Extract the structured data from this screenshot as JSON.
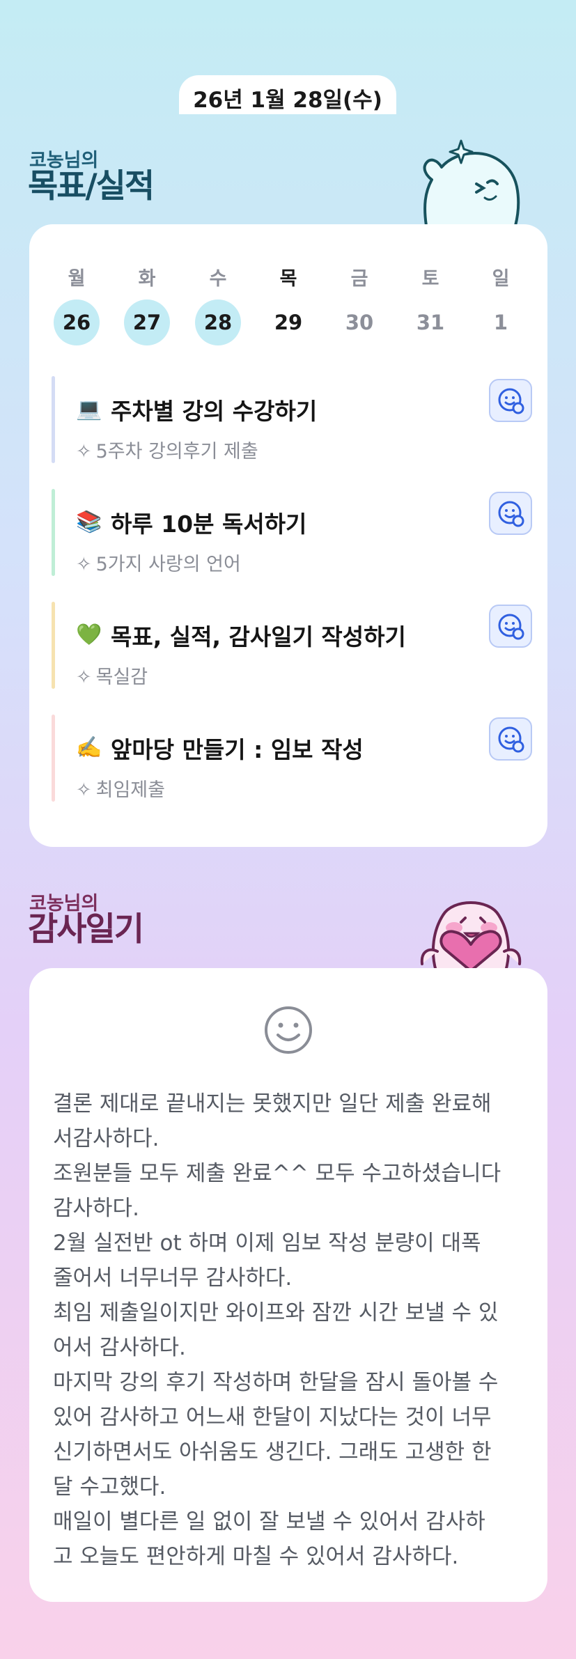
{
  "date": "26년 1월 28일(수)",
  "goals_section": {
    "owner_label": "코농님의",
    "title": "목표/실적"
  },
  "calendar": {
    "days": [
      {
        "weekday": "월",
        "num": "26",
        "state": "active"
      },
      {
        "weekday": "화",
        "num": "27",
        "state": "active"
      },
      {
        "weekday": "수",
        "num": "28",
        "state": "active"
      },
      {
        "weekday": "목",
        "num": "29",
        "state": "today"
      },
      {
        "weekday": "금",
        "num": "30",
        "state": "future"
      },
      {
        "weekday": "토",
        "num": "31",
        "state": "future"
      },
      {
        "weekday": "일",
        "num": "1",
        "state": "future"
      }
    ]
  },
  "goals": [
    {
      "icon": "laptop-icon",
      "emoji": "💻",
      "title": "주차별 강의 수강하기",
      "result": "5주차 강의후기 제출",
      "bar_color": "#d4dcf5"
    },
    {
      "icon": "books-icon",
      "emoji": "📚",
      "title": "하루 10분 독서하기",
      "result": "5가지 사랑의 언어",
      "bar_color": "#bfeed6"
    },
    {
      "icon": "green-heart-icon",
      "emoji": "💚",
      "title": "목표, 실적, 감사일기 작성하기",
      "result": "목실감",
      "bar_color": "#f6e2b0"
    },
    {
      "icon": "writing-hand-icon",
      "emoji": "✍️",
      "title": "앞마당 만들기 : 임보 작성",
      "result": "최임제출",
      "bar_color": "#fadada"
    }
  ],
  "diary_section": {
    "owner_label": "코농님의",
    "title": "감사일기"
  },
  "diary": {
    "text": "결론 제대로 끝내지는 못했지만 일단 제출 완료해\n서감사하다.\n조원분들 모두 제출 완료^^ 모두 수고하셨습니다\n감사하다.\n2월 실전반 ot 하며 이제 임보 작성 분량이 대폭\n줄어서 너무너무 감사하다.\n최임 제출일이지만 와이프와 잠깐 시간 보낼 수 있\n어서 감사하다.\n마지막 강의 후기 작성하며 한달을 잠시 돌아볼 수\n있어 감사하고 어느새 한달이 지났다는 것이 너무\n신기하면서도 아쉬움도 생긴다. 그래도 고생한 한\n달 수고했다.\n매일이 별다른 일 없이 잘 보낼 수 있어서 감사하\n고 오늘도 편안하게 마칠 수 있어서 감사하다."
  },
  "colors": {
    "accent_blue": "#2f5fe0",
    "active_day": "#c3ecf5",
    "goal_title": "#184e63",
    "diary_title": "#6a2552"
  }
}
